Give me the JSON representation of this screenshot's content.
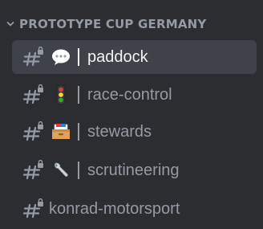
{
  "category": {
    "label": "PROTOTYPE CUP GERMANY",
    "icon": "chevron-down-icon",
    "collapsed": false
  },
  "channels": [
    {
      "name": "paddock",
      "emoji": "speech-balloon-emoji",
      "selected": true,
      "icon": "locked-text-channel-icon"
    },
    {
      "name": "race-control",
      "emoji": "traffic-light-emoji",
      "selected": false,
      "icon": "locked-text-channel-icon"
    },
    {
      "name": "stewards",
      "emoji": "card-file-box-emoji",
      "selected": false,
      "icon": "locked-text-channel-icon"
    },
    {
      "name": "scrutineering",
      "emoji": "wrench-emoji",
      "selected": false,
      "icon": "locked-text-channel-icon"
    },
    {
      "name": "konrad-motorsport",
      "emoji": "",
      "selected": false,
      "icon": "locked-text-channel-icon"
    }
  ],
  "colors": {
    "background": "#2b2d31",
    "selected_background": "#404249",
    "muted_text": "#949ba4",
    "active_text": "#f2f3f5"
  }
}
